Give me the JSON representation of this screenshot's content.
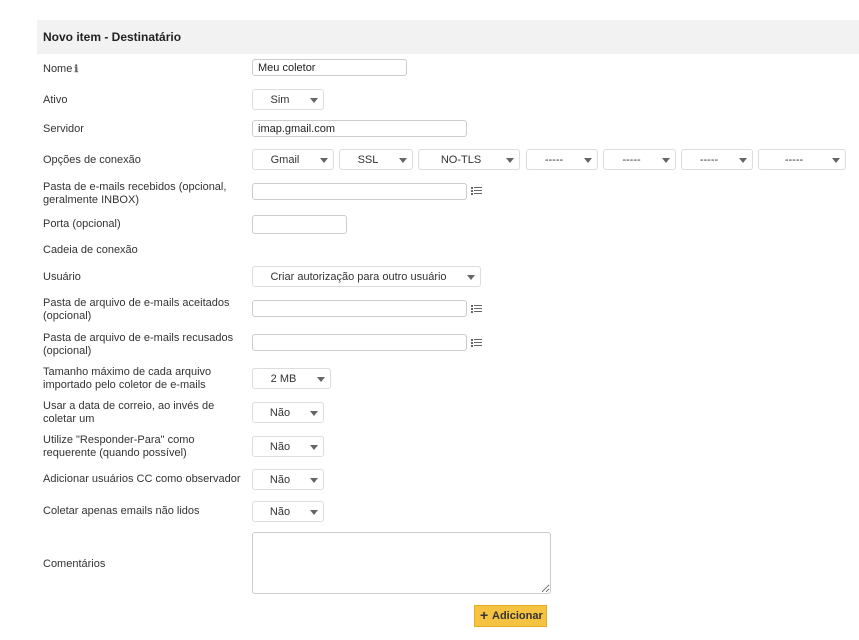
{
  "header": {
    "title": "Novo item - Destinatário"
  },
  "fields": {
    "nome": {
      "label": "Nome",
      "value": "Meu coletor"
    },
    "ativo": {
      "label": "Ativo",
      "value": "Sim"
    },
    "servidor": {
      "label": "Servidor",
      "value": "imap.gmail.com"
    },
    "opcoes": {
      "label": "Opções de conexão",
      "values": [
        "Gmail",
        "SSL",
        "NO-TLS",
        "-----",
        "-----",
        "-----",
        "-----"
      ]
    },
    "pasta_recebidos": {
      "label_line1": "Pasta de e-mails recebidos (opcional,",
      "label_line2": "geralmente INBOX)",
      "value": ""
    },
    "porta": {
      "label": "Porta (opcional)",
      "value": ""
    },
    "cadeia": {
      "label": "Cadeia de conexão"
    },
    "usuario": {
      "label": "Usuário",
      "value": "Criar autorização para outro usuário"
    },
    "pasta_aceitos": {
      "label_line1": "Pasta de arquivo de e-mails aceitados",
      "label_line2": "(opcional)",
      "value": ""
    },
    "pasta_recusados": {
      "label_line1": "Pasta de arquivo de e-mails recusados",
      "label_line2": "(opcional)",
      "value": ""
    },
    "tamanho": {
      "label_line1": "Tamanho máximo de cada arquivo",
      "label_line2": "importado pelo coletor de e-mails",
      "value": "2 MB"
    },
    "data_correio": {
      "label_line1": "Usar a data de correio, ao invés de",
      "label_line2": "coletar um",
      "value": "Não"
    },
    "responder_para": {
      "label_line1": "Utilize \"Responder-Para\" como",
      "label_line2": "requerente (quando possível)",
      "value": "Não"
    },
    "cc_observador": {
      "label": "Adicionar usuários CC como observador",
      "value": "Não"
    },
    "nao_lidos": {
      "label": "Coletar apenas emails não lidos",
      "value": "Não"
    },
    "comentarios": {
      "label": "Comentários",
      "value": ""
    }
  },
  "actions": {
    "add_label": "Adicionar"
  },
  "colors": {
    "accent": "#f5c242",
    "header_bg": "#f2f2f2"
  }
}
